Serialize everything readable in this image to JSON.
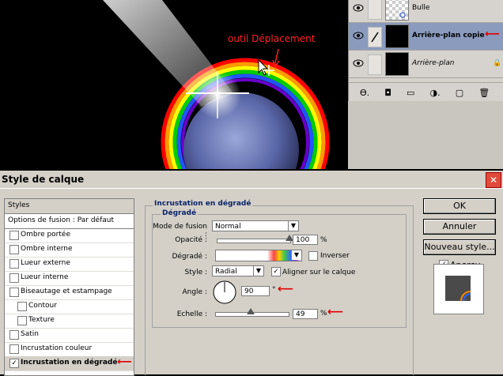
{
  "annotation": {
    "label": "outil Déplacement"
  },
  "layers": {
    "rows": [
      {
        "name": "Bulle"
      },
      {
        "name": "Arrière-plan copie"
      },
      {
        "name": "Arrière-plan"
      }
    ],
    "bottom_icons": [
      "ϴ.",
      "◘",
      "▭",
      "◑.",
      "▢",
      "🗑"
    ]
  },
  "dialog": {
    "title": "Style de calque",
    "close": "✕",
    "styles_list": {
      "header": "Styles",
      "items": [
        {
          "label": "Options de fusion : Par défaut",
          "checkbox": false,
          "indent": 0
        },
        {
          "label": "Ombre portée",
          "checkbox": true,
          "indent": 0
        },
        {
          "label": "Ombre interne",
          "checkbox": true,
          "indent": 0
        },
        {
          "label": "Lueur externe",
          "checkbox": true,
          "indent": 0
        },
        {
          "label": "Lueur interne",
          "checkbox": true,
          "indent": 0
        },
        {
          "label": "Biseautage et estampage",
          "checkbox": true,
          "indent": 0
        },
        {
          "label": "Contour",
          "checkbox": true,
          "indent": 1
        },
        {
          "label": "Texture",
          "checkbox": true,
          "indent": 1
        },
        {
          "label": "Satin",
          "checkbox": true,
          "indent": 0
        },
        {
          "label": "Incrustation couleur",
          "checkbox": true,
          "indent": 0
        },
        {
          "label": "Incrustation en dégradé",
          "checkbox": true,
          "checked": true,
          "indent": 0
        }
      ]
    },
    "panel": {
      "section_title": "Incrustation en dégradé",
      "group_title": "Dégradé",
      "blend_mode_label": "Mode de fusion :",
      "blend_mode_value": "Normal",
      "opacity_label": "Opacité :",
      "opacity_value": "100",
      "opacity_level": 1.0,
      "percent": "%",
      "gradient_label": "Dégradé :",
      "invert_label": "Inverser",
      "style_label": "Style :",
      "style_value": "Radial",
      "align_label": "Aligner sur le calque",
      "angle_label": "Angle :",
      "angle_value": "90",
      "degree": "°",
      "scale_label": "Echelle :",
      "scale_value": "49",
      "scale_level": 0.49
    },
    "buttons": {
      "ok": "OK",
      "cancel": "Annuler",
      "new_style": "Nouveau style...",
      "preview_label": "Aperçu"
    }
  },
  "arrow_glyph": "⟵",
  "colors": {
    "annotation": "#ff2222",
    "selection": "#8a9bbd",
    "group_title": "#0a246a"
  }
}
